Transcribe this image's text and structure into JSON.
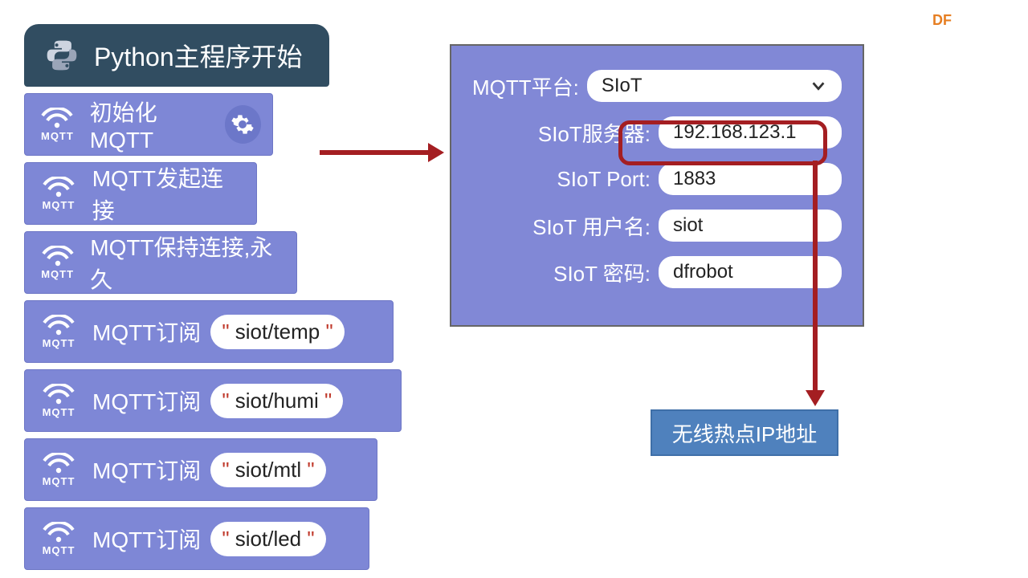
{
  "logo": "DF",
  "header": {
    "title": "Python主程序开始"
  },
  "blocks": [
    {
      "icon_label": "MQTT",
      "label": "初始化MQTT",
      "gear": true
    },
    {
      "icon_label": "MQTT",
      "label": "MQTT发起连接"
    },
    {
      "icon_label": "MQTT",
      "label": "MQTT保持连接,永久"
    },
    {
      "icon_label": "MQTT",
      "label": "MQTT订阅",
      "arg": "siot/temp"
    },
    {
      "icon_label": "MQTT",
      "label": "MQTT订阅",
      "arg": "siot/humi"
    },
    {
      "icon_label": "MQTT",
      "label": "MQTT订阅",
      "arg": "siot/mtl"
    },
    {
      "icon_label": "MQTT",
      "label": "MQTT订阅",
      "arg": "siot/led"
    }
  ],
  "panel": {
    "platform_label": "MQTT平台:",
    "platform_value": "SIoT",
    "server_label": "SIoT服务器:",
    "server_value": "192.168.123.1",
    "port_label": "SIoT Port:",
    "port_value": "1883",
    "user_label": "SIoT 用户名:",
    "user_value": "siot",
    "pass_label": "SIoT 密码:",
    "pass_value": "dfrobot"
  },
  "callout": "无线热点IP地址"
}
